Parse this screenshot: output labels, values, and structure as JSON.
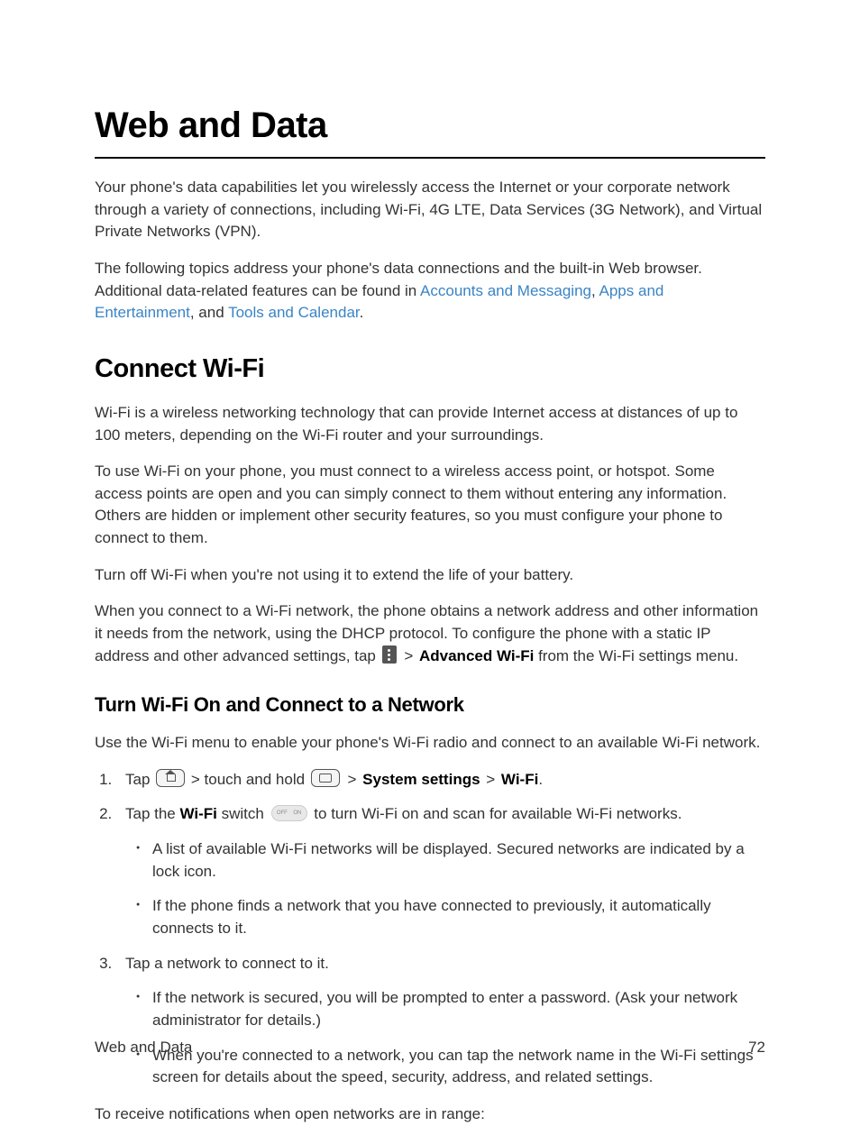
{
  "h1": "Web and Data",
  "p1a": "Your phone's data capabilities let you wirelessly access the Internet or your corporate network through a variety of connections, including Wi-Fi, 4G LTE, Data Services (3G Network), and Virtual Private Networks (VPN).",
  "p2a": "The following topics address your phone's data connections and the built-in Web browser. Additional data-related features can be found in ",
  "link1": "Accounts and Messaging",
  "p2b": ", ",
  "link2": "Apps and Entertainment",
  "p2c": ", and ",
  "link3": "Tools and Calendar",
  "p2d": ".",
  "h2": "Connect Wi-Fi",
  "p3": "Wi-Fi is a wireless networking technology that can provide Internet access at distances of up to 100 meters, depending on the Wi-Fi router and your surroundings.",
  "p4": "To use Wi-Fi on your phone, you must connect to a wireless access point, or hotspot. Some access points are open and you can simply connect to them without entering any information. Others are hidden or implement other security features, so you must configure your phone to connect to them.",
  "p5": "Turn off Wi-Fi when you're not using it to extend the life of your battery.",
  "p6a": "When you connect to a Wi-Fi network, the phone obtains a network address and other information it needs from the network, using the DHCP protocol. To configure the phone with a static IP address and other advanced settings, tap ",
  "p6b": " > ",
  "p6bold": "Advanced Wi-Fi",
  "p6c": " from the Wi-Fi settings menu.",
  "h3": "Turn Wi-Fi On and Connect to a Network",
  "p7": "Use the Wi-Fi menu to enable your phone's Wi-Fi radio and connect to an available Wi-Fi network.",
  "li1a": "Tap ",
  "li1b": " > touch and hold ",
  "li1c": " > ",
  "li1bold1": "System settings",
  "li1d": " > ",
  "li1bold2": "Wi-Fi",
  "li1e": ".",
  "li2a": "Tap the ",
  "li2bold": "Wi-Fi",
  "li2b": " switch ",
  "li2c": " to turn Wi-Fi on and scan for available Wi-Fi networks.",
  "li2sub1": "A list of available Wi-Fi networks will be displayed. Secured networks are indicated by a lock icon.",
  "li2sub2": "If the phone finds a network that you have connected to previously, it automatically connects to it.",
  "li3": "Tap a network to connect to it.",
  "li3sub1": "If the network is secured, you will be prompted to enter a password. (Ask your network administrator for details.)",
  "li3sub2": "When you're connected to a network, you can tap the network name in the Wi-Fi settings screen for details about the speed, security, address, and related settings.",
  "p8": "To receive notifications when open networks are in range:",
  "footerLeft": "Web and Data",
  "footerRight": "72",
  "switchOff": "OFF",
  "switchOn": "ON"
}
